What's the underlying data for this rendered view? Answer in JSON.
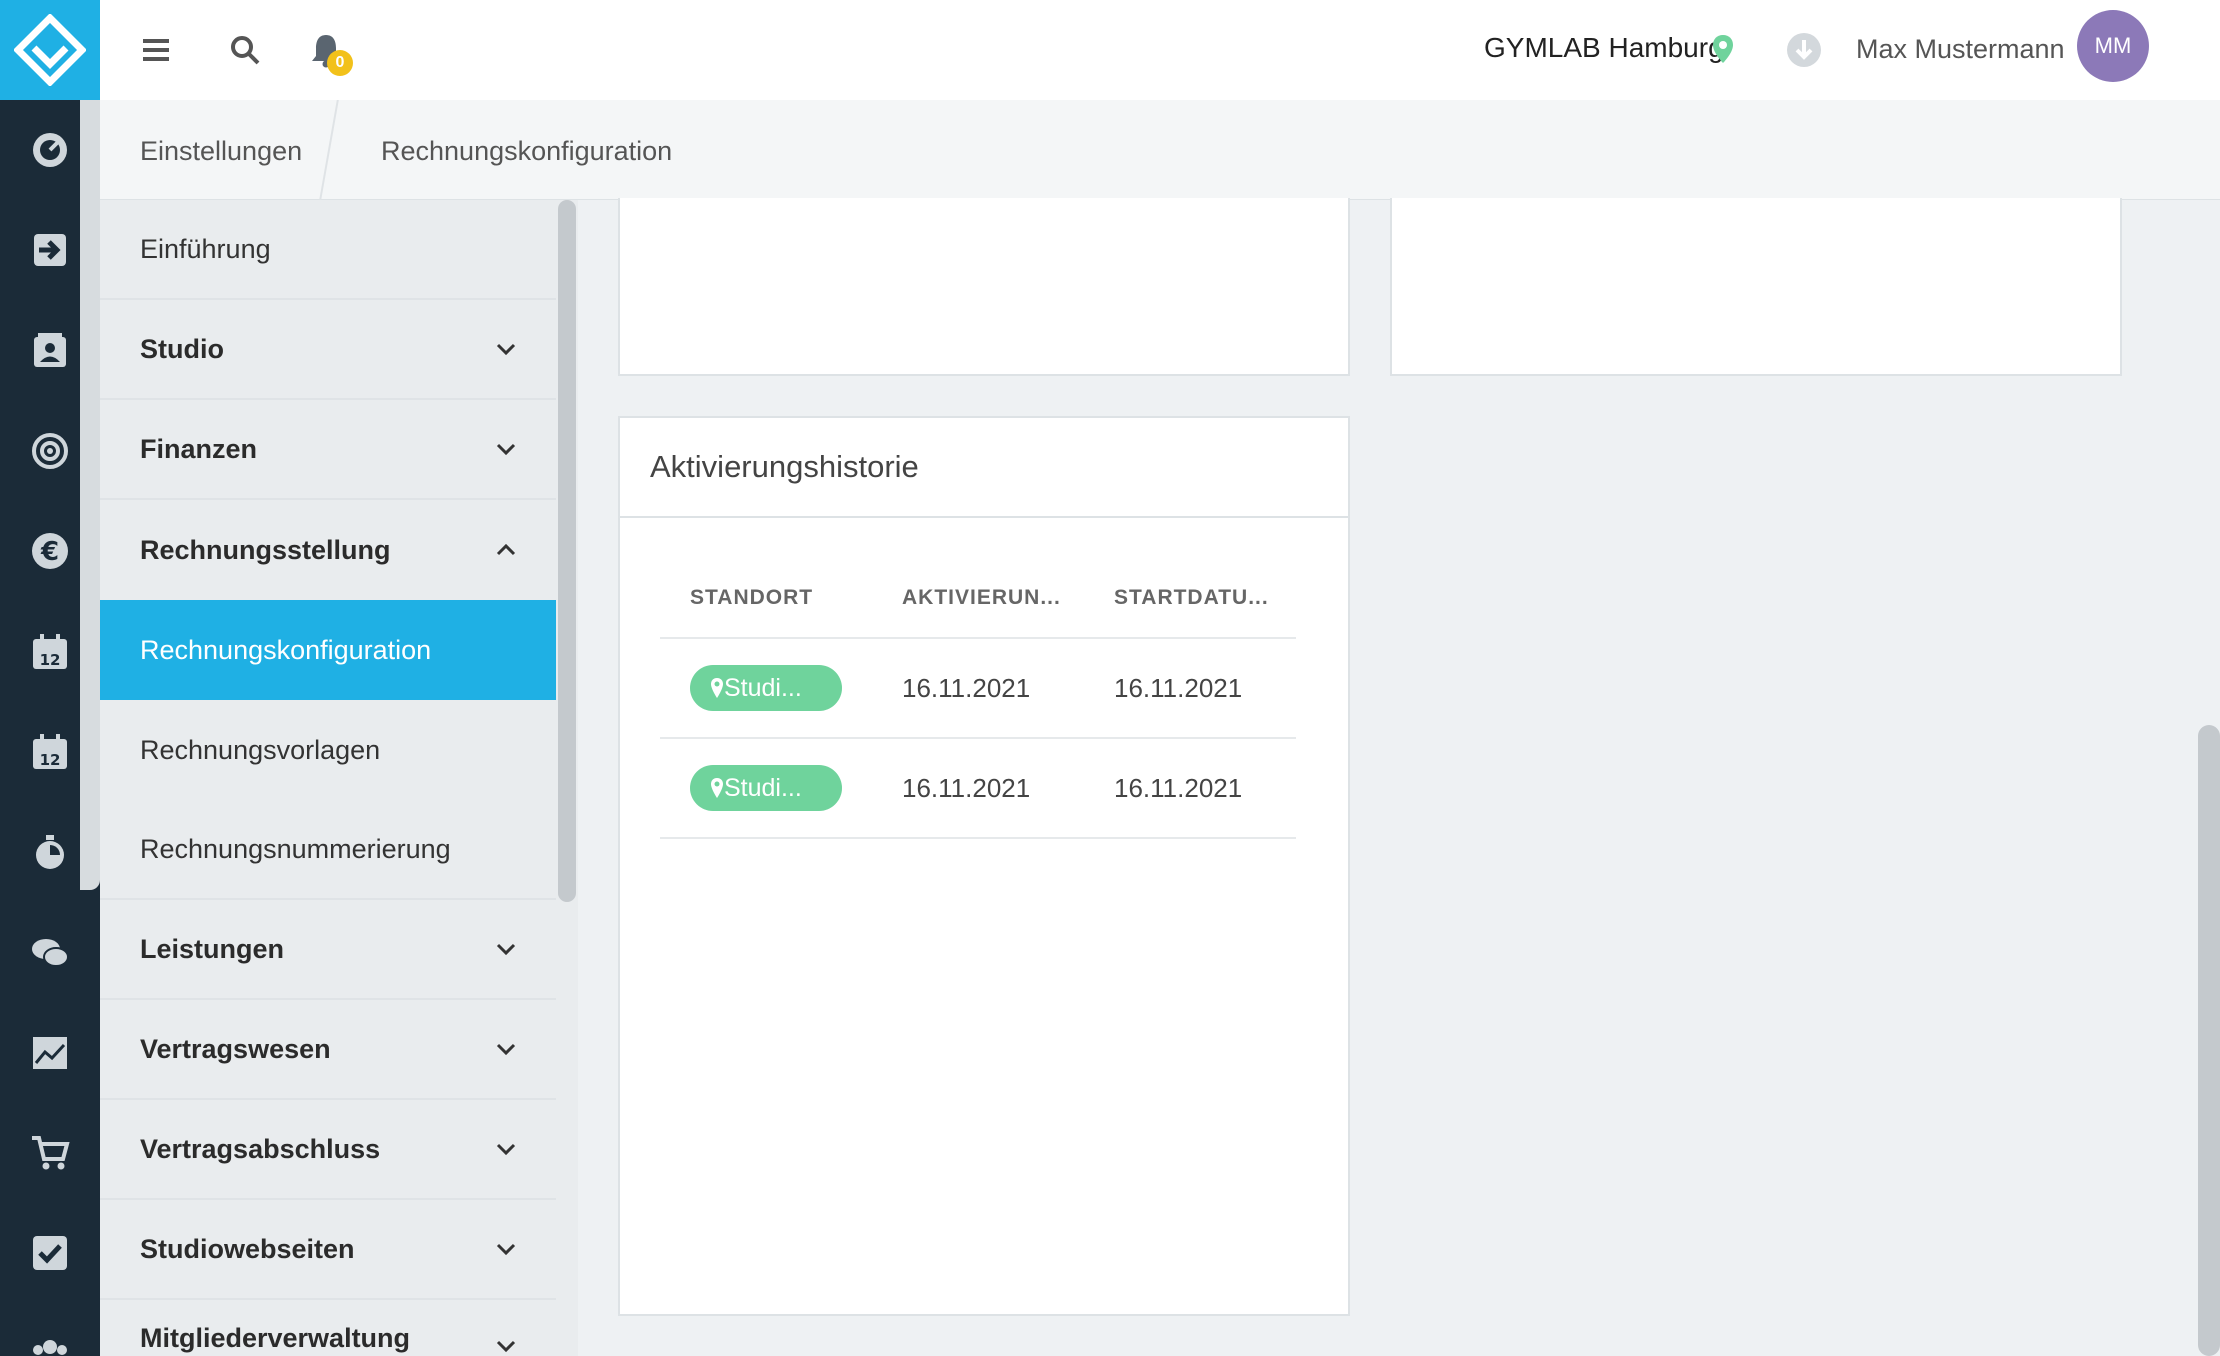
{
  "header": {
    "notification_count": "0",
    "studio": "GYMLAB Hamburg",
    "user_name": "Max Mustermann",
    "avatar_initials": "MM"
  },
  "breadcrumb": {
    "items": [
      "Einstellungen",
      "Rechnungskonfiguration"
    ]
  },
  "rail": {
    "icons": [
      "dashboard-icon",
      "checkin-icon",
      "contacts-icon",
      "target-icon",
      "euro-icon",
      "calendar-icon",
      "calendar-icon",
      "stopwatch-icon",
      "chat-icon",
      "chart-icon",
      "cart-icon",
      "checkbox-icon",
      "group-icon"
    ]
  },
  "menu": {
    "items": [
      {
        "label": "Einführung"
      },
      {
        "label": "Studio"
      },
      {
        "label": "Finanzen"
      },
      {
        "label": "Rechnungsstellung"
      },
      {
        "label": "Rechnungskonfiguration"
      },
      {
        "label": "Rechnungsvorlagen"
      },
      {
        "label": "Rechnungsnummerierung"
      },
      {
        "label": "Leistungen"
      },
      {
        "label": "Vertragswesen"
      },
      {
        "label": "Vertragsabschluss"
      },
      {
        "label": "Studiowebseiten"
      },
      {
        "label": "Mitgliederverwaltung"
      }
    ]
  },
  "history": {
    "title": "Aktivierungshistorie",
    "columns": [
      "STANDORT",
      "AKTIVIERUN...",
      "STARTDATU..."
    ],
    "rows": [
      {
        "location": "Studi...",
        "activation": "16.11.2021",
        "start": "16.11.2021"
      },
      {
        "location": "Studi...",
        "activation": "16.11.2021",
        "start": "16.11.2021"
      }
    ]
  },
  "colors": {
    "rail": "#1b2b38",
    "accent": "#1fb0e4",
    "pill": "#6fd39c",
    "badge": "#f2c11a",
    "avatar": "#8c79b8"
  }
}
